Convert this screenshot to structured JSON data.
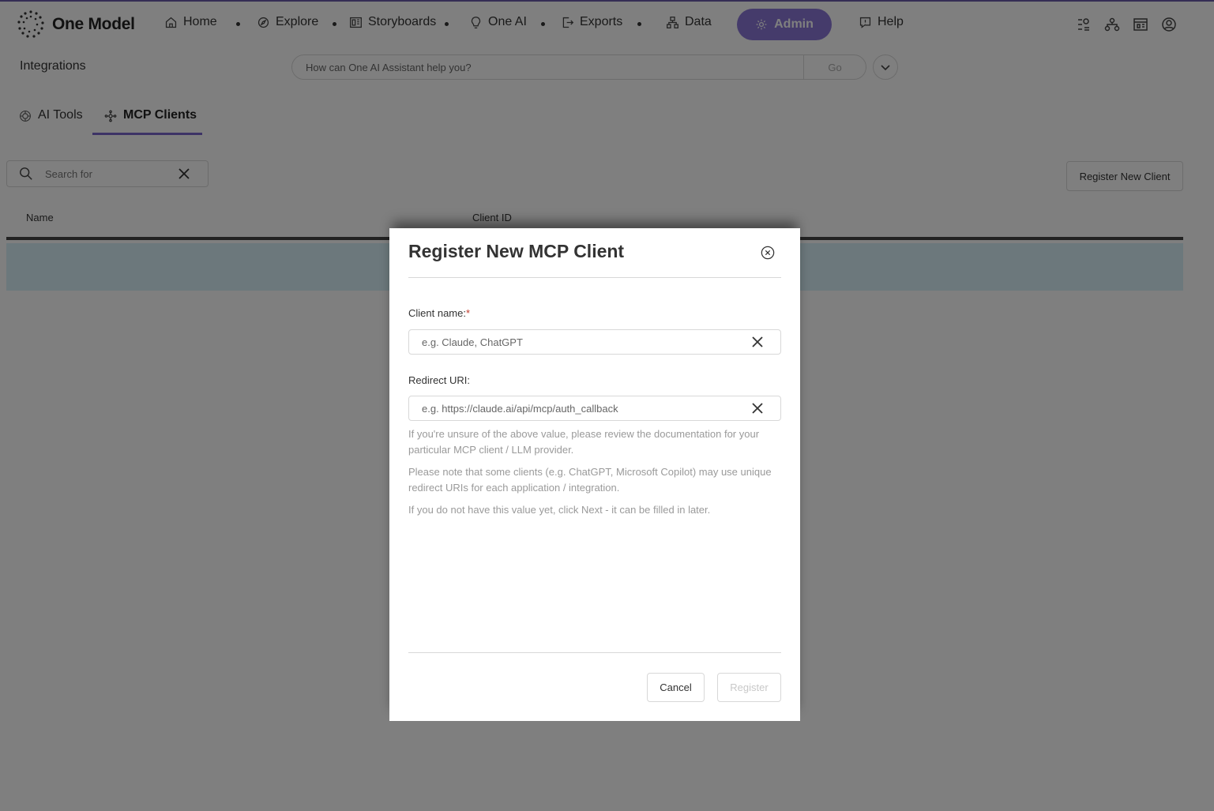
{
  "nav": {
    "logo_text": "One Model",
    "items": [
      {
        "label": "Home",
        "icon": "home-icon"
      },
      {
        "label": "Explore",
        "icon": "compass-icon"
      },
      {
        "label": "Storyboards",
        "icon": "storyboard-icon"
      },
      {
        "label": "One AI",
        "icon": "lightbulb-icon"
      },
      {
        "label": "Exports",
        "icon": "export-icon"
      },
      {
        "label": "Data",
        "icon": "data-icon"
      }
    ],
    "admin_label": "Admin",
    "help_label": "Help",
    "right_icons": [
      "settings-list-icon",
      "org-chart-icon",
      "dashboard-icon",
      "user-profile-icon"
    ]
  },
  "subheader": {
    "page_title": "Integrations",
    "assistant_placeholder": "How can One AI Assistant help you?",
    "assistant_go": "Go"
  },
  "tabs": [
    {
      "label": "AI Tools",
      "active": false
    },
    {
      "label": "MCP Clients",
      "active": true
    }
  ],
  "search": {
    "placeholder": "Search for"
  },
  "register_new_client_label": "Register New Client",
  "table": {
    "columns": [
      "Name",
      "Client ID"
    ]
  },
  "modal": {
    "title": "Register New MCP Client",
    "client_name_label": "Client name:",
    "required_marker": "*",
    "client_name_placeholder": "e.g. Claude, ChatGPT",
    "redirect_uri_label": "Redirect URI:",
    "redirect_uri_placeholder": "e.g. https://claude.ai/api/mcp/auth_callback",
    "help_1": "If you're unsure of the above value, please review the documentation for your particular MCP client / LLM provider.",
    "help_2": "Please note that some clients (e.g. ChatGPT, Microsoft Copilot) may use unique redirect URIs for each application / integration.",
    "help_3": "If you do not have this value yet, click Next - it can be filled in later.",
    "cancel_label": "Cancel",
    "register_label": "Register"
  },
  "colors": {
    "accent": "#8b76d6",
    "tab_underline": "#7a66cc",
    "row_highlight": "#d9f1f8"
  }
}
